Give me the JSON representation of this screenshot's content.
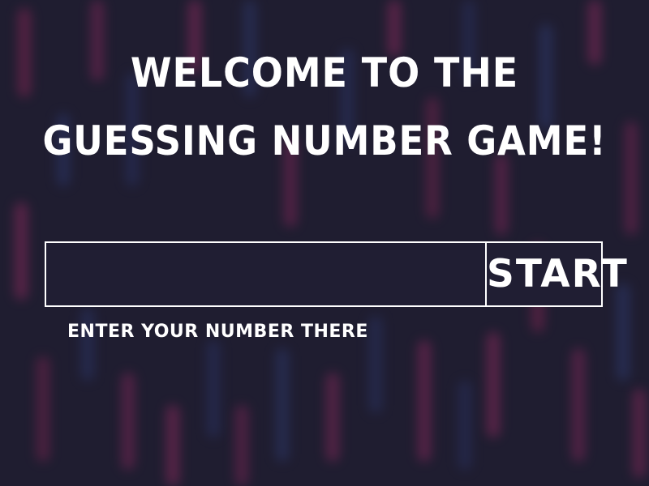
{
  "game": {
    "title_line1": "WELCOME TO THE",
    "title_line2": "GUESSING NUMBER GAME!",
    "number_input_value": "",
    "start_label": "START",
    "input_hint": "ENTER YOUR NUMBER THERE"
  },
  "colors": {
    "background": "#1f1d30",
    "text": "#ffffff",
    "streak_pink": "#8a2a5a",
    "streak_blue": "#2e3a6e"
  }
}
